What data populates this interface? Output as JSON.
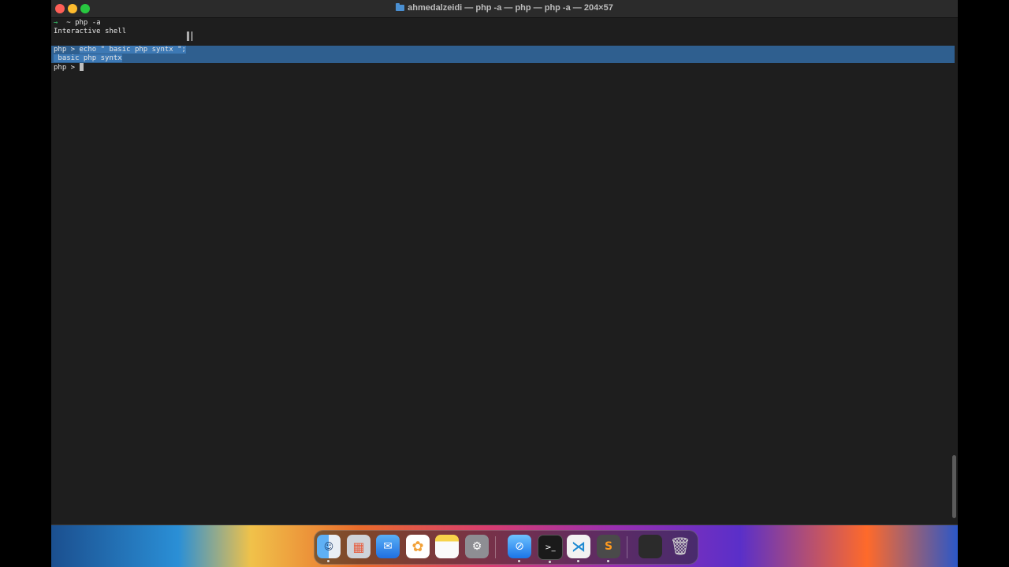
{
  "window": {
    "title": "ahmedalzeidi — php -a — php — php -a — 204×57"
  },
  "terminal": {
    "line1_prompt": "→",
    "line1_text": "  ~ php -a",
    "line2": "Interactive shell",
    "line4_prompt": "php > ",
    "line4_selected": "echo \" basic php syntx \";",
    "line5_selected": " basic php syntx",
    "line6_prompt": "php > "
  },
  "dock": {
    "apps": [
      "Finder",
      "Launchpad",
      "Mail",
      "Photos",
      "Notes",
      "System Settings",
      "Safari",
      "Terminal",
      "Visual Studio Code",
      "Sublime Text",
      "Downloads",
      "Trash"
    ]
  },
  "colors": {
    "terminal_bg": "#1e1e1e",
    "selection": "#2f5f8f",
    "prompt_green": "#35c46a"
  }
}
